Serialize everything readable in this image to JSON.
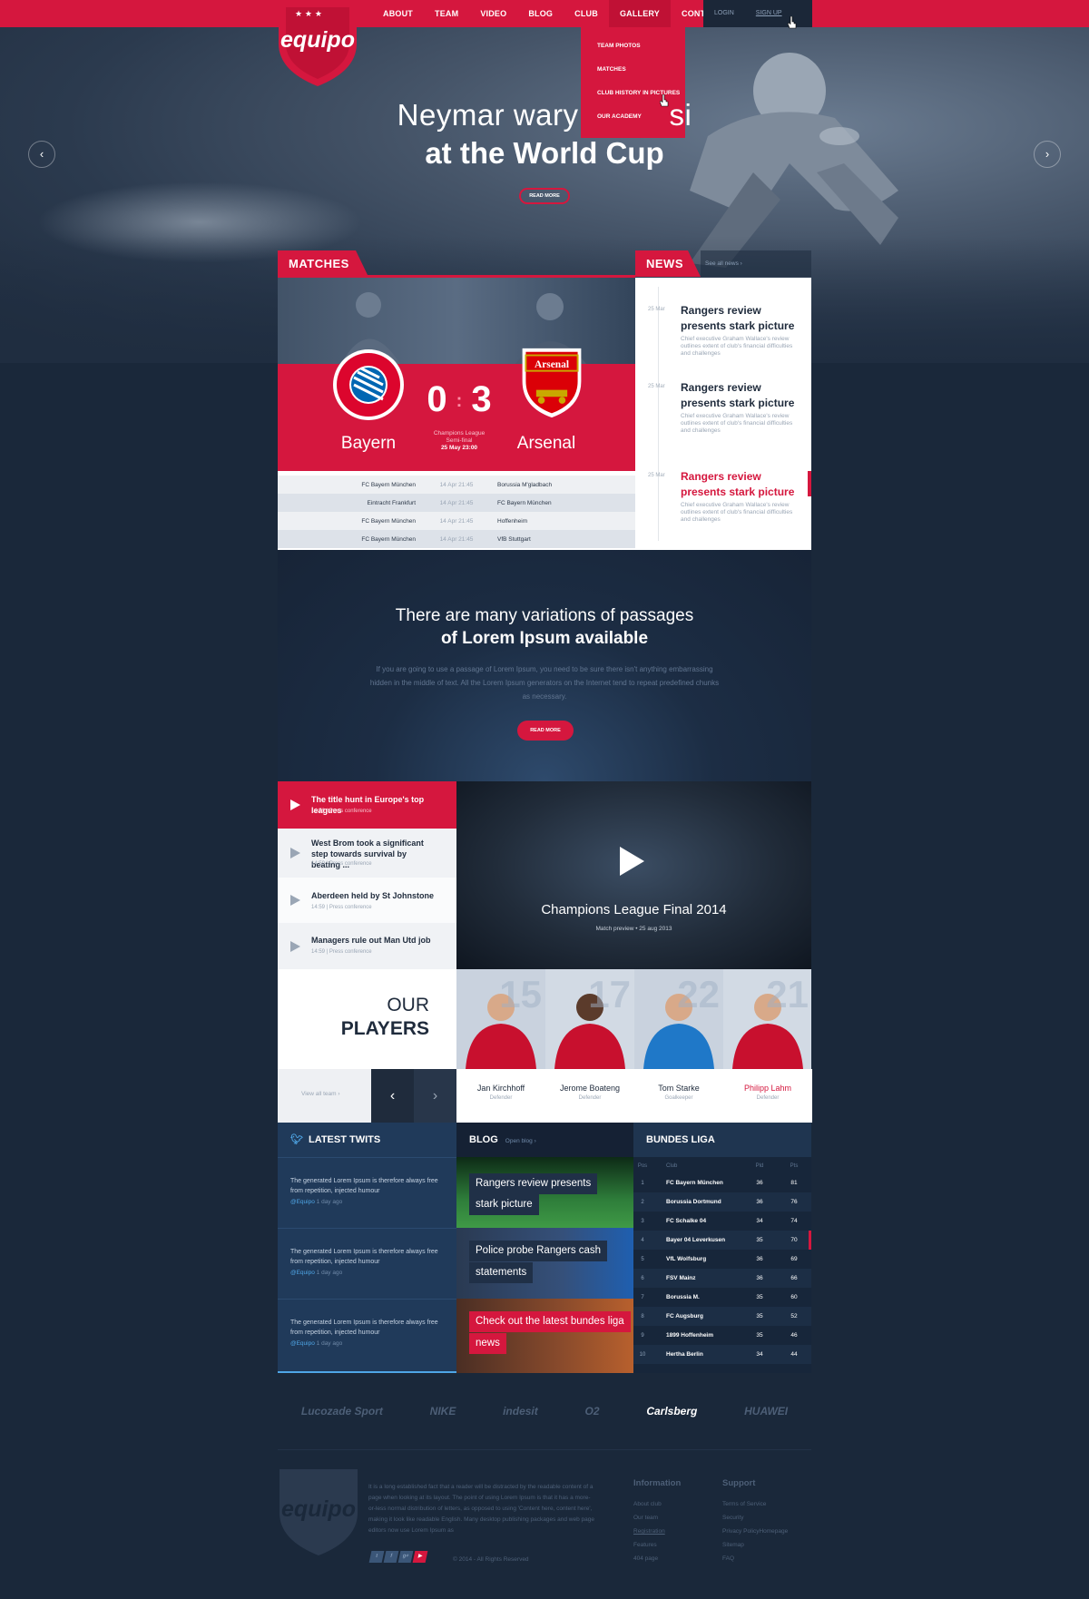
{
  "brand": {
    "name": "equipo",
    "accent": "#d5173e",
    "dark": "#1a283a"
  },
  "nav": {
    "items": [
      "ABOUT",
      "TEAM",
      "VIDEO",
      "BLOG",
      "CLUB",
      "GALLERY",
      "CONTACTS"
    ],
    "login": "LOGIN",
    "signup": "SIGN UP"
  },
  "gallery_menu": [
    "TEAM PHOTOS",
    "MATCHES",
    "CLUB HISTORY IN PICTURES",
    "OUR ACADEMY"
  ],
  "hero": {
    "title_line1": "Neymar wary",
    "title_line1_end": "si",
    "title_line2": "at the World Cup",
    "button": "READ MORE"
  },
  "matches": {
    "label": "MATCHES",
    "home": "Bayern",
    "away": "Arsenal",
    "home_score": "0",
    "away_score": "3",
    "competition": "Champions League",
    "stage": "Semi-final",
    "datetime": "25 May 23:00",
    "home_crest": "FC BAYERN MÜNCHEN",
    "away_crest": "Arsenal",
    "fixtures": [
      {
        "home": "FC Bayern München",
        "time": "14 Apr 21:45",
        "away": "Borussia M'gladbach"
      },
      {
        "home": "Eintracht Frankfurt",
        "time": "14 Apr 21:45",
        "away": "FC Bayern München"
      },
      {
        "home": "FC Bayern München",
        "time": "14 Apr 21:45",
        "away": "Hoffenheim"
      },
      {
        "home": "FC Bayern München",
        "time": "14 Apr 21:45",
        "away": "VfB Stuttgart"
      }
    ]
  },
  "news": {
    "label": "NEWS",
    "see_all": "See all news ›",
    "items": [
      {
        "date": "25 Mar",
        "title": "Rangers review presents stark picture",
        "desc": "Chief executive Graham Wallace's review outlines extent of club's financial difficulties and challenges"
      },
      {
        "date": "25 Mar",
        "title": "Rangers review presents stark picture",
        "desc": "Chief executive Graham Wallace's review outlines extent of club's financial difficulties and challenges"
      },
      {
        "date": "25 Mar",
        "title": "Rangers review presents stark picture",
        "desc": "Chief executive Graham Wallace's review outlines extent of club's financial difficulties and challenges"
      }
    ]
  },
  "promo": {
    "title_line1": "There are many variations of passages",
    "title_line2": "of Lorem Ipsum available",
    "text": "If you are going to use a passage of Lorem Ipsum, you need to be sure there isn't anything embarrassing hidden in the middle of text. All the Lorem Ipsum generators on the Internet tend to repeat predefined chunks as necessary.",
    "button": "READ MORE"
  },
  "videos": {
    "items": [
      {
        "title": "The title hunt in Europe's top leagues",
        "time": "14:59",
        "category": "Press conference"
      },
      {
        "title": "West Brom took a significant step towards survival by beating ...",
        "time": "14:59",
        "category": "Press conference"
      },
      {
        "title": "Aberdeen held by St Johnstone",
        "time": "14:59",
        "category": "Press conference"
      },
      {
        "title": "Managers rule out Man Utd job",
        "time": "14:59",
        "category": "Press conference"
      }
    ],
    "featured": {
      "title": "Champions League Final 2014",
      "meta": "Match preview  •  25 aug 2013"
    }
  },
  "players": {
    "heading_light": "OUR",
    "heading_bold": "PLAYERS",
    "view_all": "View all team ›",
    "items": [
      {
        "number": "15",
        "name": "Jan Kirchhoff",
        "role": "Defender",
        "kit": "#c8102e"
      },
      {
        "number": "17",
        "name": "Jerome Boateng",
        "role": "Defender",
        "kit": "#c8102e"
      },
      {
        "number": "22",
        "name": "Tom Starke",
        "role": "Goalkeeper",
        "kit": "#1f78c8"
      },
      {
        "number": "21",
        "name": "Philipp Lahm",
        "role": "Defender",
        "kit": "#c8102e"
      }
    ]
  },
  "twits": {
    "label": "LATEST TWITS",
    "items": [
      {
        "text": "The generated Lorem Ipsum is therefore always free from repetition, injected humour",
        "handle": "@Equipo",
        "ago": "1 day ago"
      },
      {
        "text": "The generated Lorem Ipsum is therefore always free from repetition, injected humour",
        "handle": "@Equipo",
        "ago": "1 day ago"
      },
      {
        "text": "The generated Lorem Ipsum is therefore always free from repetition, injected humour",
        "handle": "@Equipo",
        "ago": "1 day ago"
      }
    ]
  },
  "blog": {
    "label": "BLOG",
    "open": "Open blog ›",
    "items": [
      {
        "line1": "Rangers review presents",
        "line2": "stark picture"
      },
      {
        "line1": "Police probe Rangers cash",
        "line2": "statements"
      },
      {
        "line1": "Check out the latest bundes liga",
        "line2": "news"
      }
    ]
  },
  "bundesliga": {
    "label": "BUNDES LIGA",
    "columns": {
      "pos": "Pos",
      "club": "Club",
      "pld": "Pld",
      "pts": "Pts"
    },
    "rows": [
      {
        "pos": "1",
        "club": "FC Bayern München",
        "pld": "36",
        "pts": "81"
      },
      {
        "pos": "2",
        "club": "Borussia Dortmund",
        "pld": "36",
        "pts": "76"
      },
      {
        "pos": "3",
        "club": "FC Schalke 04",
        "pld": "34",
        "pts": "74"
      },
      {
        "pos": "4",
        "club": "Bayer 04 Leverkusen",
        "pld": "35",
        "pts": "70"
      },
      {
        "pos": "5",
        "club": "VfL Wolfsburg",
        "pld": "36",
        "pts": "69"
      },
      {
        "pos": "6",
        "club": "FSV Mainz",
        "pld": "36",
        "pts": "66"
      },
      {
        "pos": "7",
        "club": "Borussia M.",
        "pld": "35",
        "pts": "60"
      },
      {
        "pos": "8",
        "club": "FC Augsburg",
        "pld": "35",
        "pts": "52"
      },
      {
        "pos": "9",
        "club": "1899 Hoffenheim",
        "pld": "35",
        "pts": "46"
      },
      {
        "pos": "10",
        "club": "Hertha Berlin",
        "pld": "34",
        "pts": "44"
      }
    ]
  },
  "sponsors": [
    "Lucozade Sport",
    "NIKE",
    "indesit",
    "O2",
    "Carlsberg",
    "HUAWEI"
  ],
  "footer": {
    "about": "It is a long established fact that a reader will be distracted by the readable content of a page when looking at its layout. The point of using Lorem Ipsum is that it has a more-or-less normal distribution of letters, as opposed to using 'Content here, content here', making it look like readable English. Many desktop publishing packages and web page editors now use Lorem Ipsum as",
    "copyright": "© 2014 - All Rights Reserved",
    "social": [
      "t",
      "f",
      "g+",
      "▶"
    ],
    "information": {
      "title": "Information",
      "links": [
        "About club",
        "Our team",
        "Registration",
        "Features",
        "404 page"
      ]
    },
    "support": {
      "title": "Support",
      "links": [
        "Terms of Service",
        "Security",
        "Privacy PolicyHomepage",
        "Sitemap",
        "FAQ"
      ]
    }
  }
}
